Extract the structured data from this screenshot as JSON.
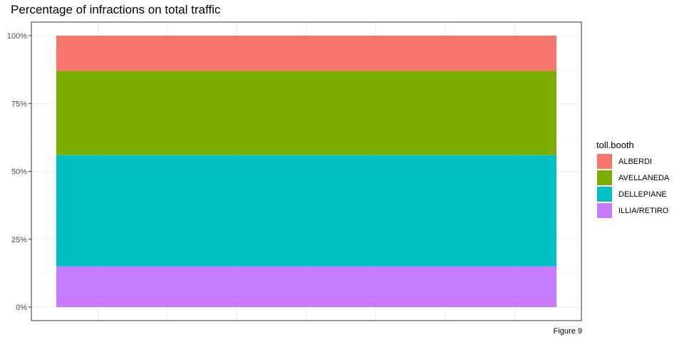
{
  "chart_data": {
    "type": "bar",
    "title": "Percentage of infractions on total traffic",
    "caption": "Figure 9",
    "xlabel": "",
    "ylabel": "",
    "ylim": [
      0,
      1
    ],
    "y_ticks": [
      0,
      0.25,
      0.5,
      0.75,
      1
    ],
    "y_tick_labels": [
      "0%",
      "25%",
      "50%",
      "75%",
      "100%"
    ],
    "stacked": true,
    "grid": true,
    "legend_title": "toll.booth",
    "legend_position": "right",
    "series": [
      {
        "name": "ALBERDI",
        "color": "#F8766D",
        "value": 0.13
      },
      {
        "name": "AVELLANEDA",
        "color": "#7CAE00",
        "value": 0.31
      },
      {
        "name": "DELLEPIANE",
        "color": "#00BFC4",
        "value": 0.41
      },
      {
        "name": "ILLIA/RETIRO",
        "color": "#C77CFF",
        "value": 0.15
      }
    ]
  }
}
